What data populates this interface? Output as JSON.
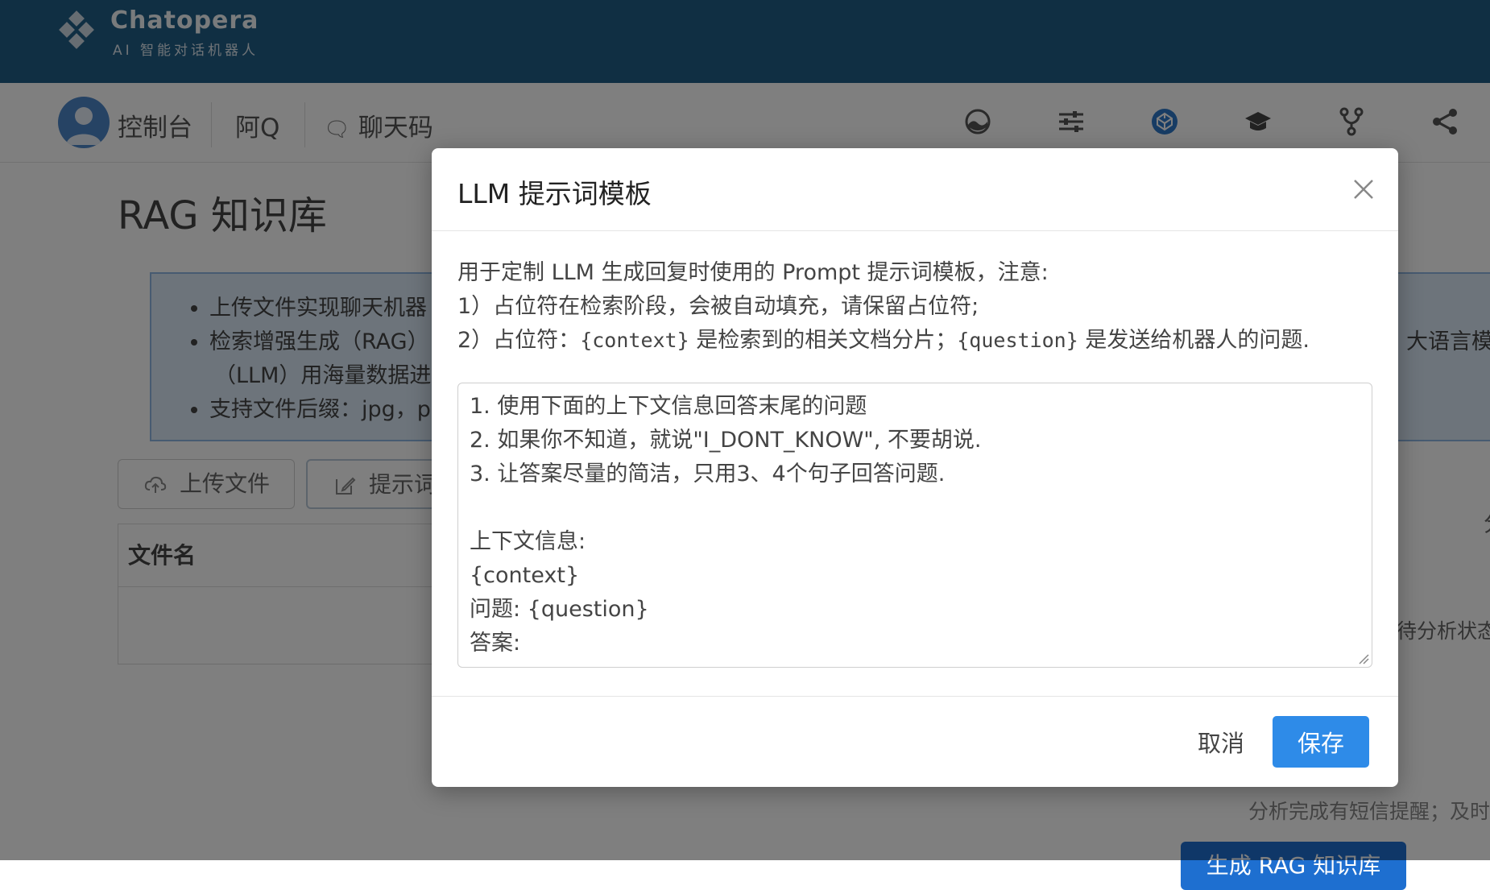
{
  "header": {
    "brand": "Chatopera",
    "tagline": "AI 智能对话机器人"
  },
  "nav": {
    "console": "控制台",
    "aq": "阿Q",
    "chatcode": "聊天码",
    "icons": [
      "dashboard-icon",
      "sliders-icon",
      "codepen-icon",
      "graduation-cap-icon",
      "code-fork-icon",
      "share-icon"
    ]
  },
  "page": {
    "title": "RAG 知识库",
    "info": {
      "bullet1": "上传文件实现聊天机器",
      "bullet2": "检索增强生成（RAG）",
      "bullet2_cont": "（LLM）用海量数据进",
      "bullet3": "支持文件后缀：jpg，p",
      "right_fragment": "大语言模"
    },
    "upload_button": "上传文件",
    "prompt_button": "提示词",
    "table_header_filename": "文件名",
    "right_char": "分",
    "right_status": "待分析状态",
    "right_note": "分析完成有短信提醒；及时了",
    "right_button": "生成 RAG 知识库"
  },
  "modal": {
    "title": "LLM 提示词模板",
    "desc_line1": "用于定制 LLM 生成回复时使用的 Prompt 提示词模板，注意:",
    "desc_line2": "1）占位符在检索阶段，会被自动填充，请保留占位符;",
    "desc_line3_prefix": "2）占位符：",
    "desc_line3_code1": "{context}",
    "desc_line3_mid": " 是检索到的相关文档分片；",
    "desc_line3_code2": "{question}",
    "desc_line3_suffix": " 是发送给机器人的问题.",
    "template": "1. 使用下面的上下文信息回答末尾的问题\n2. 如果你不知道，就说\"I_DONT_KNOW\", 不要胡说.\n3. 让答案尽量的简洁，只用3、4个句子回答问题.\n\n上下文信息:\n{context}\n问题: {question}\n答案:",
    "cancel": "取消",
    "save": "保存"
  },
  "colors": {
    "header_bg": "#215e86",
    "primary": "#2e8be8",
    "overlay": "rgba(0,0,0,0.5)"
  }
}
